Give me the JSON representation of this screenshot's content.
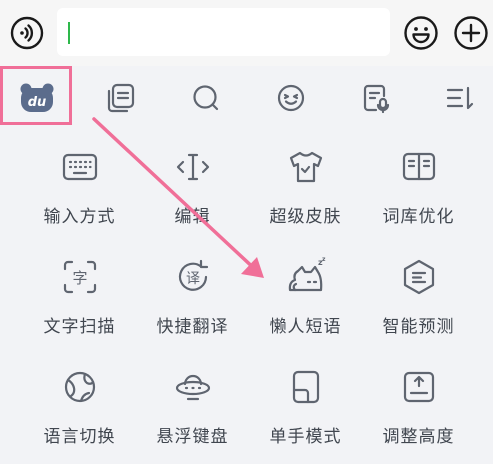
{
  "input": {
    "value": "",
    "placeholder": ""
  },
  "toolbar": {
    "items": [
      {
        "icon": "bear-du-logo-icon",
        "selected": true
      },
      {
        "icon": "clipboard-icon"
      },
      {
        "icon": "search-icon"
      },
      {
        "icon": "emoji-icon"
      },
      {
        "icon": "voice-note-icon"
      },
      {
        "icon": "menu-collapse-icon"
      }
    ]
  },
  "grid": {
    "items": [
      {
        "label": "输入方式",
        "icon": "keyboard-icon"
      },
      {
        "label": "编辑",
        "icon": "text-cursor-icon"
      },
      {
        "label": "超级皮肤",
        "icon": "tshirt-icon"
      },
      {
        "label": "词库优化",
        "icon": "book-icon"
      },
      {
        "label": "文字扫描",
        "icon": "scan-text-icon"
      },
      {
        "label": "快捷翻译",
        "icon": "translate-icon"
      },
      {
        "label": "懒人短语",
        "icon": "lazy-cat-icon"
      },
      {
        "label": "智能预测",
        "icon": "smart-predict-icon"
      },
      {
        "label": "语言切换",
        "icon": "globe-icon"
      },
      {
        "label": "悬浮键盘",
        "icon": "ufo-icon"
      },
      {
        "label": "单手模式",
        "icon": "one-hand-icon"
      },
      {
        "label": "调整高度",
        "icon": "adjust-height-icon"
      }
    ]
  },
  "colors": {
    "highlight": "#f06f98",
    "arrow": "#f06f98",
    "cursor": "#2eb84b",
    "icon": "#5f6570",
    "label": "#40464f",
    "background": "#f2f3f6"
  }
}
